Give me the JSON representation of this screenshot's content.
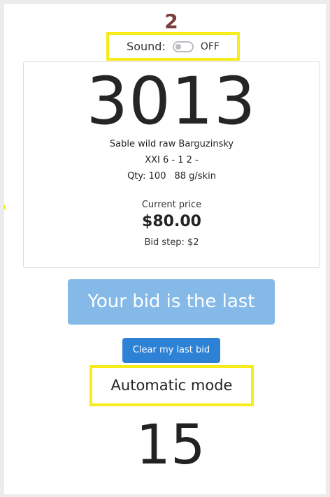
{
  "header": {
    "badge_number": "2"
  },
  "sound": {
    "label": "Sound:",
    "state": "OFF",
    "enabled": false
  },
  "lot": {
    "number": "3013",
    "name": "Sable wild raw Barguzinsky",
    "grade": "XXI 6 - 1 2 -",
    "qty": "Qty: 100",
    "weight": "88 g/skin",
    "price_caption": "Current price",
    "price": "$80.00",
    "bid_step": "Bid step: $2"
  },
  "bid": {
    "status_label": "Your bid is the last",
    "clear_label": "Clear my last bid"
  },
  "auto": {
    "mode_label": "Automatic mode",
    "countdown": "15"
  },
  "colors": {
    "highlight": "#f5ec1a",
    "primary_button": "#2d82d6",
    "status_button": "#84b9e8",
    "badge": "#7a3e3e"
  },
  "icons": {
    "sound_toggle": "toggle-switch-off-icon"
  }
}
